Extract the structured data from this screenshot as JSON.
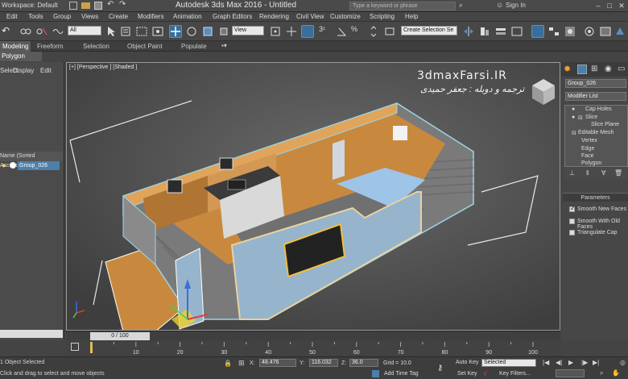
{
  "titlebar": {
    "workspace": "Workspace: Default",
    "title": "Autodesk 3ds Max 2016 - Untitled",
    "search_placeholder": "Type a keyword or phrase",
    "signin": "Sign In"
  },
  "menu": [
    "Edit",
    "Tools",
    "Group",
    "Views",
    "Create",
    "Modifiers",
    "Animation",
    "Graph Editors",
    "Rendering",
    "Civil View",
    "Customize",
    "Scripting",
    "Help"
  ],
  "toolbar": {
    "selection_filter": "All",
    "ref_coord": "View",
    "named_selection": "Create Selection Se"
  },
  "ribbon": {
    "tabs": [
      "Modeling",
      "Freeform",
      "Selection",
      "Object Paint",
      "Populate"
    ],
    "subtab": "Polygon Modeling"
  },
  "scene_explorer": {
    "tabs": [
      "Select",
      "Display",
      "Edit"
    ],
    "column": "Name (Sorted Ascending)",
    "object": "Group_026"
  },
  "viewport": {
    "label": "[+] [Perspective ] [Shaded ]",
    "watermark_title": "3dmaxFarsi.IR",
    "watermark_sub": "ترجمه و دوبله : جعفر حمیدی"
  },
  "command_panel": {
    "object_name": "Group_026",
    "modifier_list": "Modifier List",
    "stack": [
      "Cap Holes",
      "Slice",
      "Slice Plane",
      "Editable Mesh",
      "Vertex",
      "Edge",
      "Face",
      "Polygon"
    ],
    "params_title": "Parameters",
    "options": [
      {
        "label": "Smooth New Faces",
        "checked": true
      },
      {
        "label": "Smooth With Old Faces",
        "checked": false
      },
      {
        "label": "Triangulate Cap",
        "checked": false
      }
    ]
  },
  "timeline": {
    "frame": "0 / 100",
    "ticks": [
      "10",
      "20",
      "30",
      "40",
      "50",
      "60",
      "70",
      "80",
      "90",
      "100"
    ]
  },
  "status": {
    "selected": "1 Object Selected",
    "prompt": "Click and drag to select and move objects",
    "x_label": "X:",
    "x": "48.476",
    "y_label": "Y:",
    "y": "116.032",
    "z_label": "Z:",
    "z": "36.0",
    "grid": "Grid = 10.0",
    "auto_key": "Auto Key",
    "set_key": "Set Key",
    "key_mode": "Selected",
    "key_filters": "Key Filters...",
    "add_time_tag": "Add Time Tag"
  },
  "colors": {
    "selection_blue": "#4d7fa8",
    "wood": "#c8893f",
    "floor": "#707070"
  }
}
